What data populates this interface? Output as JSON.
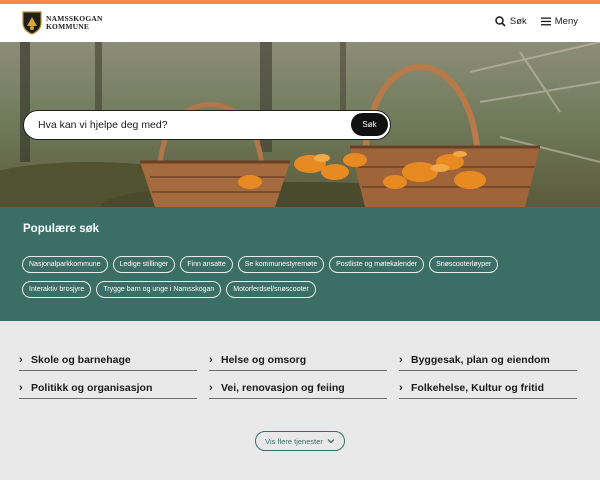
{
  "header": {
    "logo_line1": "NAMSSKOGAN",
    "logo_line2": "KOMMUNE",
    "search_label": "Søk",
    "menu_label": "Meny"
  },
  "hero": {
    "search_placeholder": "Hva kan vi hjelpe deg med?",
    "search_button": "Søk"
  },
  "popular": {
    "title": "Populære søk",
    "chips": [
      "Nasjonalparkkommune",
      "Ledige stillinger",
      "Finn ansatte",
      "Se kommunestyremøte",
      "Postliste og møtekalender",
      "Snøscooterløyper",
      "Interaktiv brosjyre",
      "Trygge barn og unge i Namsskogan",
      "Motorferdsel/snøscooter"
    ]
  },
  "services": {
    "items": [
      "Skole og barnehage",
      "Helse og omsorg",
      "Byggesak, plan og eiendom",
      "Politikk og organisasjon",
      "Vei, renovasjon og feiing",
      "Folkehelse, Kultur og fritid"
    ],
    "more_label": "Vis flere tjenester"
  },
  "colors": {
    "accent_top": "#f58a4b",
    "teal": "#3a6e66",
    "services_bg": "#e9e9e9"
  }
}
